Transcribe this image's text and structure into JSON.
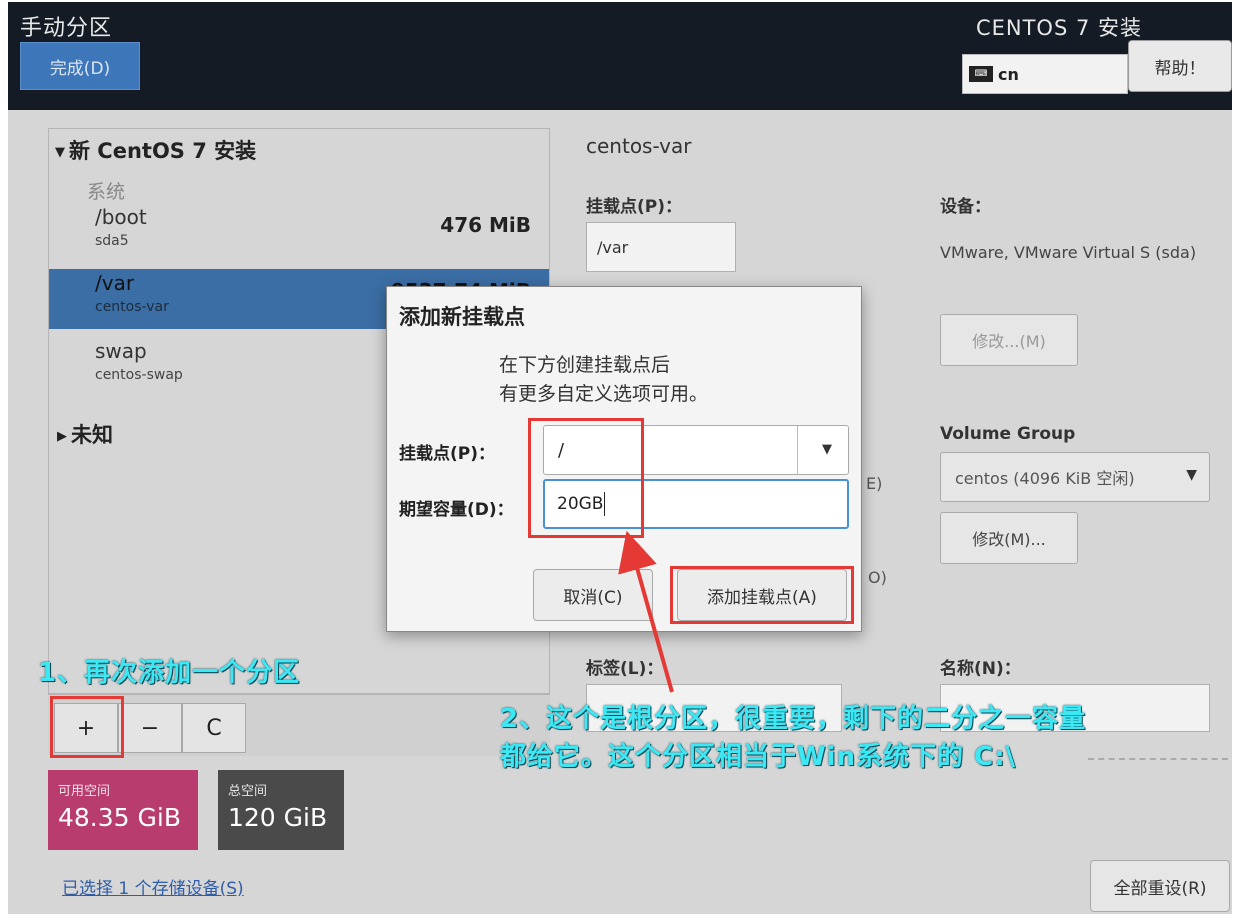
{
  "header": {
    "title": "手动分区",
    "done_label": "完成(D)",
    "product": "CENTOS 7 安装",
    "keyboard_icon_glyph": "⌨",
    "keyboard_layout": "cn",
    "help_label": "帮助！"
  },
  "tree": {
    "group_title": "新 CentOS 7 安装",
    "section_system": "系统",
    "partitions": [
      {
        "name": "/boot",
        "device": "sda5",
        "size": "476 MiB",
        "selected": false
      },
      {
        "name": "/var",
        "device": "centos-var",
        "size": "9537.74 MiB",
        "selected": true
      },
      {
        "name": "swap",
        "device": "centos-swap",
        "size": "",
        "selected": false
      }
    ],
    "unknown_title": "未知"
  },
  "toolbar": {
    "add_label": "+",
    "remove_label": "−",
    "refresh_label": "C"
  },
  "space": {
    "available_label": "可用空间",
    "available_value": "48.35 GiB",
    "total_label": "总空间",
    "total_value": "120 GiB"
  },
  "storage_link": "已选择 1 个存储设备(S)",
  "reset_label": "全部重设(R)",
  "detail": {
    "title": "centos-var",
    "mount_label": "挂载点(P)：",
    "mount_value": "/var",
    "device_label": "设备：",
    "device_value": "VMware, VMware Virtual S (sda)",
    "modify_label": "修改...(M)",
    "vg_label": "Volume Group",
    "vg_value": "centos  (4096 KiB 空闲)",
    "vg_modify_label": "修改(M)...",
    "tag_label": "标签(L)：",
    "name_label": "名称(N)：",
    "frag_e": "E)",
    "frag_o": "O)"
  },
  "dialog": {
    "title": "添加新挂载点",
    "desc_line1": "在下方创建挂载点后",
    "desc_line2": "有更多自定义选项可用。",
    "mount_label": "挂载点(P)：",
    "mount_value": "/",
    "capacity_label": "期望容量(D)：",
    "capacity_value": "20GB",
    "cancel_label": "取消(C)",
    "add_label": "添加挂载点(A)"
  },
  "annotations": {
    "note1": "1、再次添加一个分区",
    "note2_line1": "2、这个是根分区，很重要，剩下的二分之一容量",
    "note2_line2": "都给它。这个分区相当于Win系统下的 C:\\"
  }
}
